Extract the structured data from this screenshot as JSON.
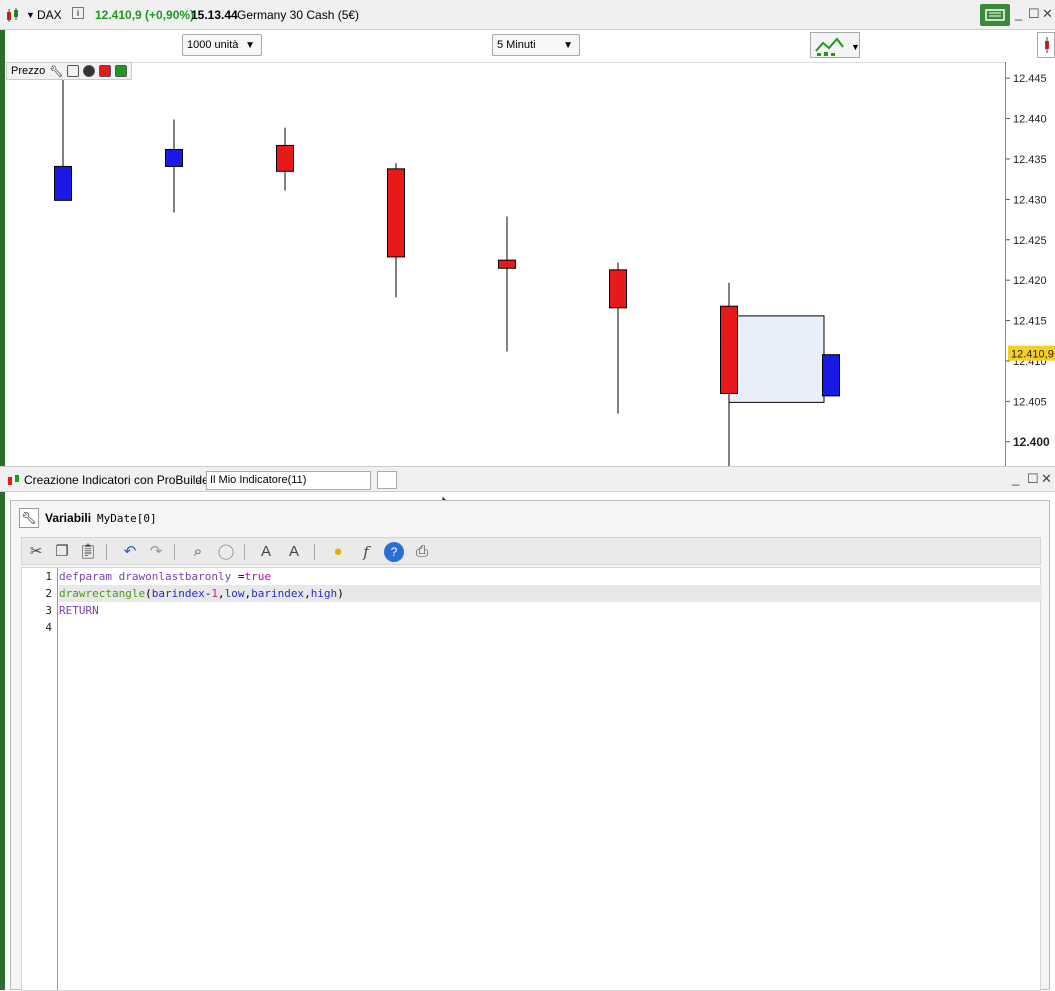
{
  "titlebar": {
    "instrument": "DAX",
    "price_change": "12.410,9 (+0,90%)",
    "time": "15.13.44",
    "instrument_name": "Germany 30 Cash (5€)"
  },
  "toolbar": {
    "units_select": "1000 unità",
    "timeframe_select": "5 Minuti"
  },
  "chart": {
    "panel_label": "Prezzo",
    "current_price": "12.410,9",
    "y_ticks": [
      "12.445",
      "12.440",
      "12.435",
      "12.430",
      "12.425",
      "12.420",
      "12.415",
      "12.410",
      "12.405",
      "12.400"
    ]
  },
  "chart_data": {
    "type": "candlestick",
    "ylim": [
      12397.0,
      12447.0
    ],
    "candles": [
      {
        "open": 12430.0,
        "close": 12434.2,
        "high": 12446.0,
        "low": 12430.0,
        "dir": "up"
      },
      {
        "open": 12434.2,
        "close": 12436.3,
        "high": 12440.0,
        "low": 12428.5,
        "dir": "up"
      },
      {
        "open": 12436.8,
        "close": 12433.6,
        "high": 12439.0,
        "low": 12431.2,
        "dir": "down"
      },
      {
        "open": 12433.9,
        "close": 12423.0,
        "high": 12434.6,
        "low": 12418.0,
        "dir": "down"
      },
      {
        "open": 12422.6,
        "close": 12421.6,
        "high": 12428.0,
        "low": 12411.3,
        "dir": "down"
      },
      {
        "open": 12421.4,
        "close": 12416.7,
        "high": 12422.3,
        "low": 12403.6,
        "dir": "down"
      },
      {
        "open": 12416.9,
        "close": 12406.1,
        "high": 12419.8,
        "low": 12397.0,
        "dir": "down"
      },
      {
        "open": 12405.8,
        "close": 12410.9,
        "high": 12410.9,
        "low": 12405.8,
        "dir": "up"
      }
    ],
    "rectangle": {
      "from_bar": 6,
      "to_bar": 7,
      "low": 12405.0,
      "high": 12415.7
    },
    "colors": {
      "up": "#1a1ae6",
      "down": "#e61a1a",
      "rect_fill": "#e8eefa",
      "current_price_bg": "#f5d020"
    }
  },
  "probuilder": {
    "title": "Creazione Indicatori con ProBuilder",
    "separator": "-",
    "indicator_name": "Il Mio Indicatore(11)",
    "variables_label": "Variabili",
    "variable": "MyDate[0]"
  },
  "code": {
    "line_numbers": [
      "1",
      "2",
      "3",
      "4"
    ],
    "line1_kw": "defparam",
    "line1_a": " drawonlastbaronly ",
    "line1_eq": "=",
    "line1_val": "true",
    "line2_fn": "drawrectangle",
    "line2_p1": "(",
    "line2_bi1": "barindex",
    "line2_minus": "-",
    "line2_one": "1",
    "line2_c1": ",",
    "line2_low": "low",
    "line2_c2": ",",
    "line2_bi2": "barindex",
    "line2_c3": ",",
    "line2_high": "high",
    "line2_p2": ")",
    "line3": "RETURN"
  }
}
